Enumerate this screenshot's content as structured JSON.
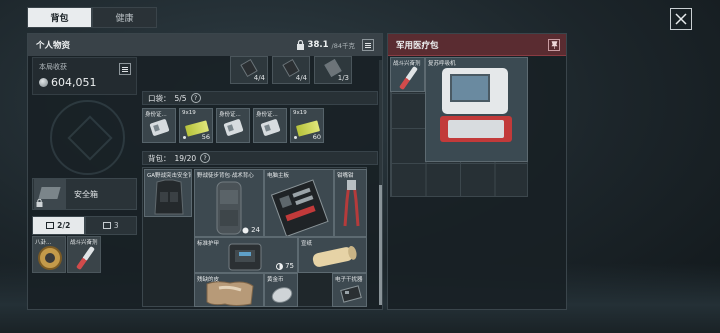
{
  "tabs": {
    "backpack": "背包",
    "health": "健康"
  },
  "personal": {
    "title": "个人物资",
    "weight_value": "38.1",
    "weight_max": "/84千克",
    "earnings_label": "本局收获",
    "earnings_value": "604,051"
  },
  "safe_box_label": "安全箱",
  "sub_tabs": {
    "wards": "2/2",
    "other": "3"
  },
  "wards": [
    {
      "label": "八卦..."
    },
    {
      "label": "战斗兴奋剂"
    }
  ],
  "equip_counts": [
    "4/4",
    "4/4",
    "1/3"
  ],
  "pocket": {
    "label": "口袋：",
    "value": "5/5",
    "items": [
      {
        "label": "身份证...",
        "count": ""
      },
      {
        "label": "9x19",
        "count": "56"
      },
      {
        "label": "身份证...",
        "count": ""
      },
      {
        "label": "身份证...",
        "count": ""
      },
      {
        "label": "9x19",
        "count": "60"
      }
    ]
  },
  "bag": {
    "label": "背包：",
    "value": "19/20",
    "items": {
      "ga_vest": "GA野战突击安全背包",
      "camo_pack": "野战徒步背包·战术背心",
      "motherboard": "电脑主板",
      "cutter": "钳嘴钳",
      "armor_count": "24",
      "standard_armor": "标准护甲",
      "armor_durability": "75",
      "paper": "宣纸",
      "fur": "残缺的皮",
      "coin": "黄金币",
      "jammer": "电子干扰器"
    }
  },
  "medical": {
    "title": "军用医疗包",
    "items": [
      {
        "label": "战斗兴奋剂"
      },
      {
        "label": "复苏呼吸机"
      }
    ]
  },
  "colors": {
    "accent_red": "#5a2c31",
    "panel": "#182024",
    "ammo": "#c9d24a"
  },
  "icons": [
    "close-icon",
    "lock-icon",
    "menu-icon",
    "coin-icon",
    "pin-icon"
  ]
}
